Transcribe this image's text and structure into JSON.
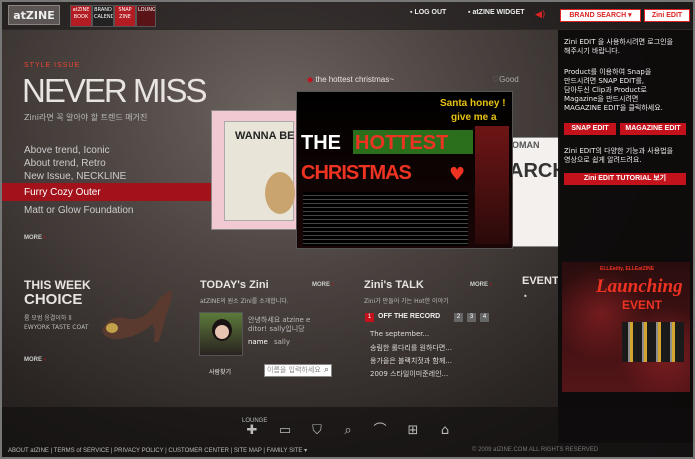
{
  "header": {
    "logo": "atZINE",
    "nav_tabs": [
      "atZINE BOOK",
      "BRAND CALENDAR",
      "SNAP ZINE",
      "LOUNGE"
    ],
    "logout": "LOG OUT",
    "widget": "atZINE WIDGET",
    "brand_search": "BRAND SEARCH ▾",
    "zini_edit": "Zini EDIT"
  },
  "hero": {
    "section_label": "STYLE ISSUE",
    "title": "NEVER MISS",
    "subtitle": "Zini라면 꼭 알아야 할 트렌드 매거진",
    "menu": [
      "Above trend, Iconic",
      "About trend, Retro",
      "New Issue, NECKLINE",
      "Furry Cozy Outer",
      "Matt or Glow Foundation"
    ],
    "more": "MORE",
    "feature_label": "the hottest christmas~",
    "feature_good": "Good",
    "left_mag": "WANNA BE",
    "right_mag_top": "OMAN",
    "right_mag_word": "ARCH",
    "main_mag": {
      "line1": "Santa honey !",
      "line2": "give me a",
      "the": "THE",
      "hottest": "HOTTEST",
      "christmas": "CHRISTMAS"
    }
  },
  "this_week": {
    "title1": "THIS WEEK",
    "title2": "CHOICE",
    "desc": "룸 모범 응결이하 ll EWYORK TASTE COAT",
    "more": "MORE"
  },
  "todays_zini": {
    "title": "TODAY's Zini",
    "more": "MORE",
    "desc": "atZINE의 원소 Zini를 소개합니다.",
    "intro1": "안녕하세요 atzine e",
    "intro2": "ditor! sally입니당",
    "name_label": "name",
    "name_value": "sally",
    "search_label": "사람찾기",
    "search_placeholder": "이름을 입력하세요"
  },
  "zinis_talk": {
    "title": "Zini's TALK",
    "more": "MORE",
    "desc": "Zini가 만들어 가는 Hot한 이야기",
    "record_num": "1",
    "record_title": "OFF THE RECORD",
    "pages": [
      "2",
      "3",
      "4"
    ],
    "items": [
      "The september...",
      "송림한 롤다리를 원하다면...",
      "옹가을은 블랙치젓과 함께...",
      "2009 스타일이미준레인..."
    ]
  },
  "event": {
    "title": "EVENT",
    "banner_brand": "ELLEatity, ELLEatZINE",
    "banner_title1": "Launching",
    "banner_title2": "EVENT"
  },
  "side_panel": {
    "intro": [
      "Zini EDIT 을 사용하시려면 로그인을",
      "해주시기 바랍니다."
    ],
    "product": [
      "Product를 이용하여 Snap을",
      "만드시려면 SNAP EDIT를,",
      "담아두신 Clip과 Product로",
      "Magazine을 만드시려면",
      "MAGAZINE EDIT을 클릭하세요."
    ],
    "snap_edit": "SNAP EDIT",
    "magazine_edit": "MAGAZINE EDIT",
    "tutorial_desc": [
      "Zini EDIT의 다양한 기능과 사용법을",
      "영상으로 쉽게 알려드려요."
    ],
    "tutorial_button": "Zini EDIT TUTORIAL 보기"
  },
  "footer": {
    "lounge_label": "LOUNGE",
    "links": "ABOUT atZINE  |  TERMS of SERVICE  |  PRIVACY POLICY  |  CUSTOMER CENTER  |  SITE MAP  |  FAMILY SITE ▾",
    "copyright": "© 2009 atZINE.COM ALL RIGHTS RESERVED",
    "icons": [
      "lounge-puzzle-icon",
      "monitor-icon",
      "shopping-bag-icon",
      "magnifier-icon",
      "hanger-icon",
      "gift-icon",
      "chair-icon"
    ]
  },
  "colors": {
    "accent": "#c3121b",
    "text_light": "#e8e4e2"
  }
}
